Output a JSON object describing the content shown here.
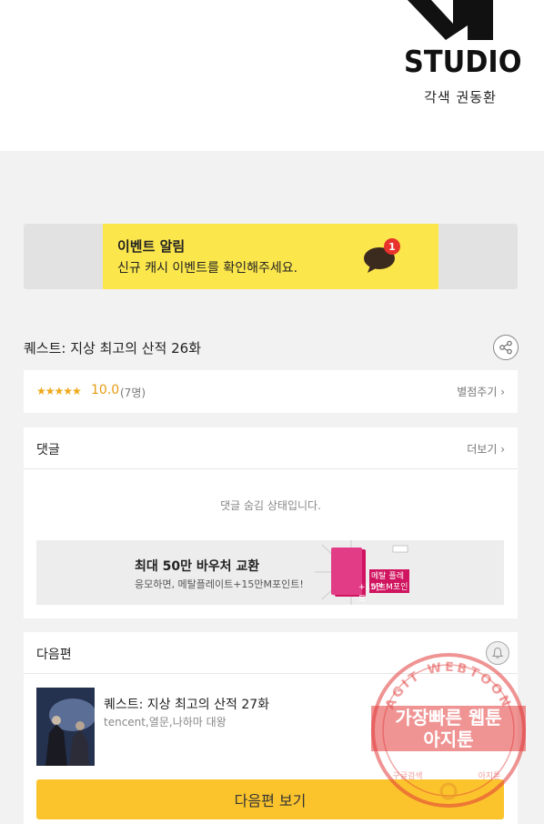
{
  "header": {
    "logo_word": "STUDIO",
    "credit": "각색 권동환"
  },
  "event_banner": {
    "title": "이벤트 알림",
    "subtitle": "신규 캐시 이벤트를 확인해주세요.",
    "badge_count": "1"
  },
  "episode": {
    "title": "퀘스트: 지상 최고의 산적 26화"
  },
  "rating": {
    "stars": "★★★★★",
    "score": "10.0",
    "count": "(7명)",
    "rate_link": "별점주기 ›"
  },
  "comments": {
    "title": "댓글",
    "more_link": "더보기 ›",
    "hidden_message": "댓글 숨김 상태입니다."
  },
  "ad": {
    "title": "최대 50만 바우처 교환",
    "subtitle": "응모하면, 메탈플레이트+15만M포인트!",
    "card_text1": "메탈 플레이트",
    "card_text2": "+15만 M포인트"
  },
  "next_episode": {
    "section_title": "다음편",
    "title": "퀘스트: 지상 최고의 산적 27화",
    "authors": "tencent,열문,나하마 대왕",
    "button_label": "다음편 보기"
  },
  "watermark": {
    "ring_text": "AGIT WEBTOON",
    "line1": "가장빠른 웹툰",
    "line2": "아지툰",
    "bottom_left": "구글검색",
    "bottom_right": "아지툰"
  },
  "colors": {
    "event_yellow": "#fbe64c",
    "button_yellow": "#fbc42d",
    "star_orange": "#f0a818",
    "watermark_red": "#e23b3b"
  }
}
